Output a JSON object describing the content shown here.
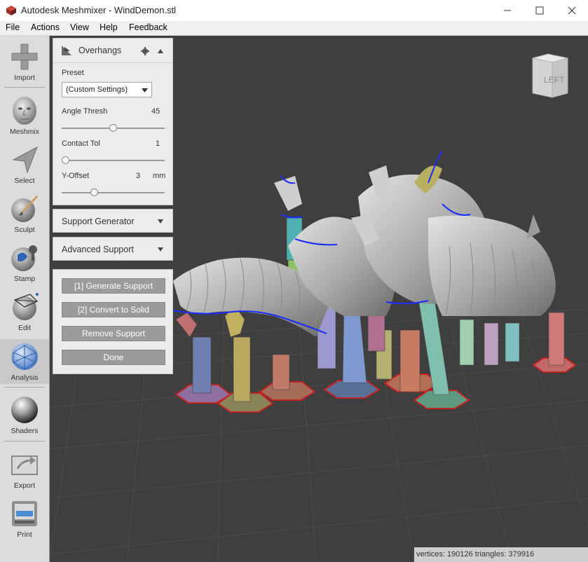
{
  "window": {
    "title": "Autodesk Meshmixer - WindDemon.stl"
  },
  "menu": [
    "File",
    "Actions",
    "View",
    "Help",
    "Feedback"
  ],
  "toolbar": {
    "tools": [
      {
        "label": "Import",
        "icon": "plus-icon"
      },
      {
        "label": "Meshmix",
        "icon": "head-icon"
      },
      {
        "label": "Select",
        "icon": "cursor-arrow-icon"
      },
      {
        "label": "Sculpt",
        "icon": "brush-icon"
      },
      {
        "label": "Stamp",
        "icon": "stamp-icon"
      },
      {
        "label": "Edit",
        "icon": "mesh-edit-icon"
      },
      {
        "label": "Analysis",
        "icon": "analysis-sphere-icon"
      },
      {
        "label": "Shaders",
        "icon": "shader-sphere-icon"
      },
      {
        "label": "Export",
        "icon": "export-icon"
      },
      {
        "label": "Print",
        "icon": "printer-icon"
      }
    ],
    "active": "Analysis"
  },
  "overhangs_panel": {
    "title": "Overhangs",
    "preset_label": "Preset",
    "preset_value": "(Custom Settings)",
    "angle_label": "Angle Thresh",
    "angle_value": "45",
    "angle_fraction": 0.5,
    "contact_label": "Contact Tol",
    "contact_value": "1",
    "contact_fraction": 0.0,
    "yoffset_label": "Y-Offset",
    "yoffset_value": "3",
    "yoffset_unit": "mm",
    "yoffset_fraction": 0.3
  },
  "support_generator": {
    "title": "Support Generator"
  },
  "advanced_support": {
    "title": "Advanced Support"
  },
  "actions": {
    "generate": "[1] Generate Support",
    "convert": "[2] Convert to Solid",
    "remove": "Remove Support",
    "done": "Done"
  },
  "view_cube": {
    "label": "LEFT"
  },
  "status": {
    "text": "vertices: 190126 triangles: 379916"
  }
}
